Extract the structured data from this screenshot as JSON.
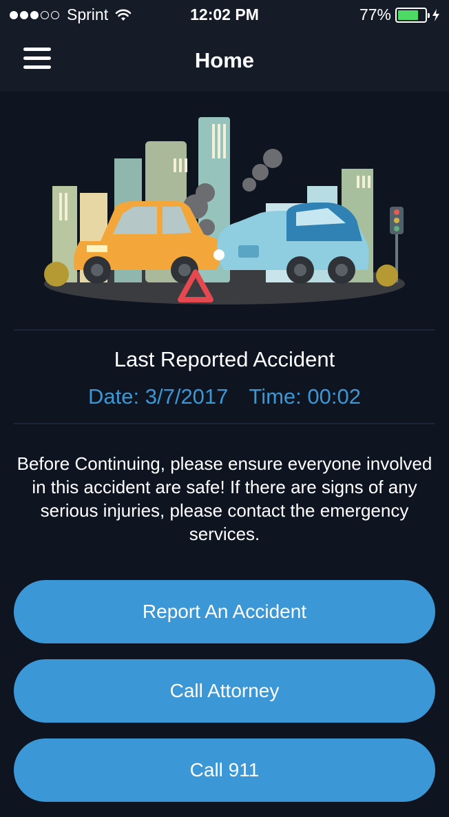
{
  "status_bar": {
    "carrier": "Sprint",
    "time": "12:02 PM",
    "battery_percent": "77%",
    "battery_level": 0.77,
    "signal_dots_filled": 3,
    "signal_dots_total": 5
  },
  "nav": {
    "title": "Home",
    "menu_icon": "hamburger-menu-icon"
  },
  "hero_image": {
    "subject": "car-accident-city-illustration"
  },
  "last_accident": {
    "title": "Last Reported Accident",
    "date_label": "Date: 3/7/2017",
    "time_label": "Time: 00:02"
  },
  "notice": "Before Continuing, please ensure everyone involved in this accident are safe! If there are signs of any serious injuries, please contact the emergency services.",
  "buttons": {
    "report": "Report An Accident",
    "attorney": "Call Attorney",
    "emergency": "Call 911"
  },
  "colors": {
    "background": "#0e1520",
    "nav_background": "#151c28",
    "accent": "#3b97d6",
    "battery": "#4cd964"
  }
}
